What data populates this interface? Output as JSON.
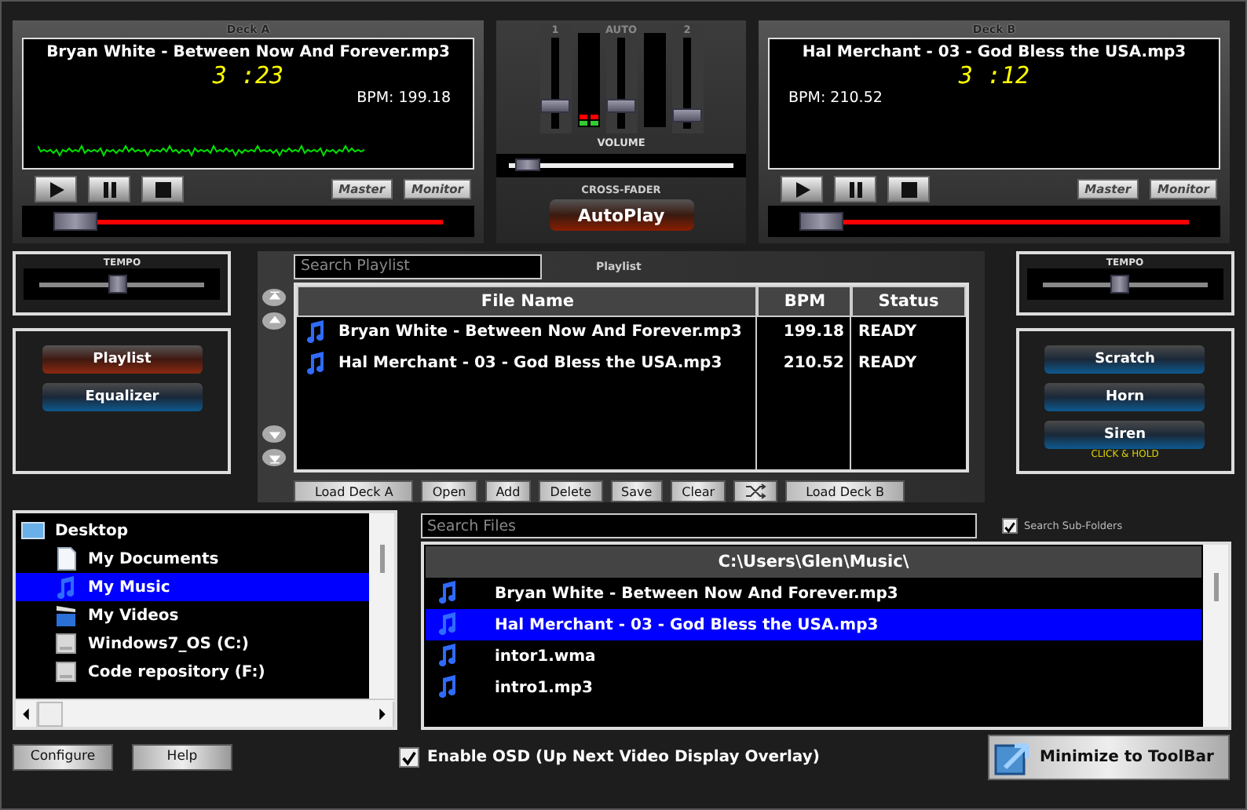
{
  "decks": [
    {
      "label": "Deck A",
      "title": "Bryan White - Between Now And Forever.mp3",
      "time": "3 :23",
      "bpm": "BPM: 199.18",
      "waveform": true,
      "position": {
        "level": 0.0
      },
      "buttons": [
        {
          "label": "Master",
          "disabled": true
        },
        {
          "label": "Monitor",
          "disabled": true
        }
      ]
    },
    {
      "label": "Deck B",
      "title": "Hal Merchant - 03 - God Bless the USA.mp3",
      "time": "3 :12",
      "bpm": "BPM: 210.52",
      "waveform": false,
      "position": {
        "level": 0.0
      },
      "buttons": [
        {
          "label": "Master",
          "disabled": true
        },
        {
          "label": "Monitor",
          "disabled": true
        }
      ]
    }
  ],
  "mixer": {
    "faders": [
      {
        "label": "1",
        "level": 0.22
      },
      {
        "label": "AUTO",
        "level": 0.22
      },
      {
        "label": "2",
        "level": 0.08
      }
    ],
    "volume_label": "VOLUME",
    "crossfader": {
      "label": "CROSS-FADER",
      "level": 0.04
    },
    "autoplay": "AutoPlay"
  },
  "tempo": [
    {
      "label": "TEMPO",
      "level": 0.47
    },
    {
      "label": "TEMPO",
      "level": 0.47
    }
  ],
  "views": [
    {
      "label": "Playlist",
      "selected": true
    },
    {
      "label": "Equalizer",
      "selected": false
    }
  ],
  "effects": {
    "buttons": [
      "Scratch",
      "Horn",
      "Siren"
    ],
    "note": "CLICK & HOLD"
  },
  "playlist": {
    "search": {
      "placeholder": "Search Playlist"
    },
    "title": "Playlist",
    "columns": [
      "File Name",
      "BPM",
      "Status"
    ],
    "rows": [
      {
        "name": "Bryan White - Between Now And Forever.mp3",
        "bpm": "199.18",
        "status": "READY"
      },
      {
        "name": "Hal Merchant - 03 - God Bless the USA.mp3",
        "bpm": "210.52",
        "status": "READY"
      }
    ],
    "buttons": [
      {
        "kind": "text",
        "label": "Load Deck A"
      },
      {
        "kind": "text",
        "label": "Open"
      },
      {
        "kind": "text",
        "label": "Add"
      },
      {
        "kind": "text",
        "label": "Delete"
      },
      {
        "kind": "text",
        "label": "Save"
      },
      {
        "kind": "text",
        "label": "Clear"
      },
      {
        "kind": "shuffle"
      },
      {
        "kind": "text",
        "label": "Load Deck B"
      }
    ]
  },
  "folders": {
    "root": {
      "label": "Desktop",
      "kind": "desktop",
      "children": [
        {
          "label": "My Documents",
          "kind": "document",
          "selected": false
        },
        {
          "label": "My Music",
          "kind": "music",
          "selected": true
        },
        {
          "label": "My Videos",
          "kind": "video",
          "selected": false
        },
        {
          "label": "Windows7_OS (C:)",
          "kind": "drive",
          "selected": false
        },
        {
          "label": "Code repository (F:)",
          "kind": "drive",
          "selected": false
        }
      ]
    }
  },
  "files": {
    "search": {
      "placeholder": "Search Files"
    },
    "subfolders": {
      "label": "Search Sub-Folders",
      "checked": true
    },
    "path": "C:\\Users\\Glen\\Music\\",
    "rows": [
      {
        "name": "Bryan White - Between Now And Forever.mp3",
        "selected": false
      },
      {
        "name": "Hal Merchant - 03 - God Bless the USA.mp3",
        "selected": true
      },
      {
        "name": "intor1.wma",
        "selected": false
      },
      {
        "name": "intro1.mp3",
        "selected": false
      }
    ]
  },
  "footer": {
    "configure": "Configure",
    "help": "Help",
    "osd": {
      "label": "Enable OSD (Up Next Video Display Overlay)",
      "checked": true
    },
    "minimize": "Minimize to ToolBar"
  }
}
